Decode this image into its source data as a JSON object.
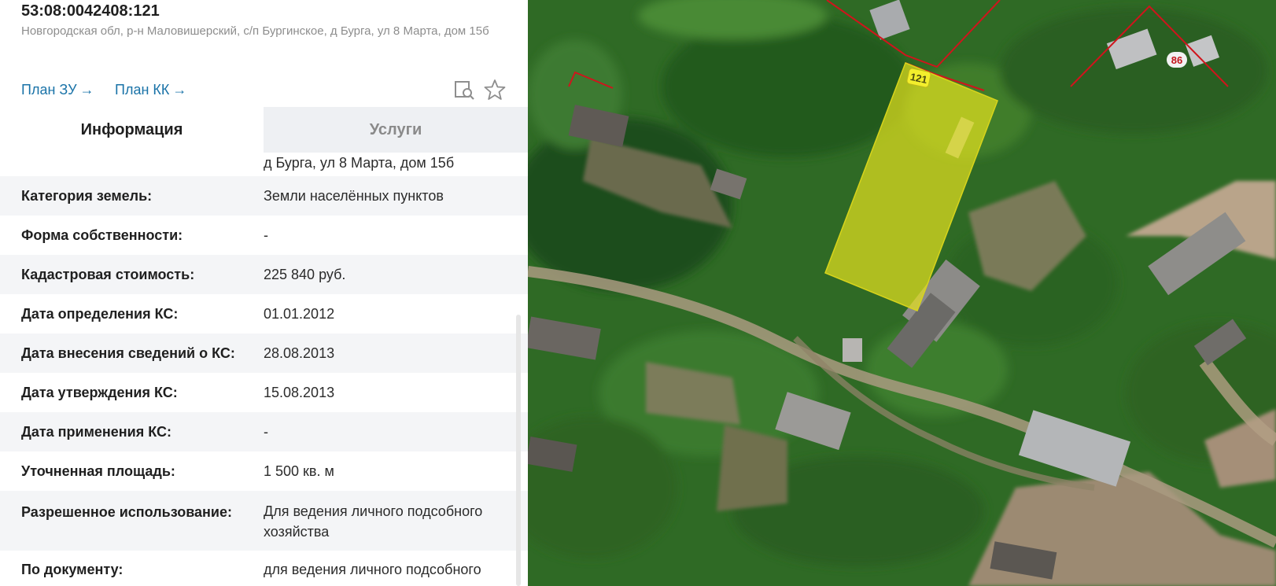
{
  "parcel": {
    "cadastral_number": "53:08:0042408:121",
    "address": "Новгородская обл, р-н Маловишерский, с/п Бургинское, д Бурга, ул 8 Марта, дом 15б"
  },
  "links": {
    "plan_zu": "План ЗУ",
    "plan_kk": "План КК",
    "arrow": "→"
  },
  "tools": {
    "search_icon": "search-doc-icon",
    "favorite_icon": "star-icon"
  },
  "tabs": {
    "info": "Информация",
    "services": "Услуги"
  },
  "details": {
    "address_tail": "д Бурга, ул 8 Марта, дом 15б",
    "rows": [
      {
        "label": "Категория земель:",
        "value": "Земли населённых пунктов"
      },
      {
        "label": "Форма собственности:",
        "value": "-"
      },
      {
        "label": "Кадастровая стоимость:",
        "value": "225 840 руб."
      },
      {
        "label": "Дата определения КС:",
        "value": "01.01.2012"
      },
      {
        "label": "Дата внесения сведений о КС:",
        "value": "28.08.2013"
      },
      {
        "label": "Дата утверждения КС:",
        "value": "15.08.2013"
      },
      {
        "label": "Дата применения КС:",
        "value": "-"
      },
      {
        "label": "Уточненная площадь:",
        "value": "1 500 кв. м"
      },
      {
        "label": "Разрешенное использование:",
        "value": "Для ведения личного подсобного хозяйства"
      },
      {
        "label": "По документу:",
        "value": "для ведения личного подсобного"
      }
    ]
  },
  "map": {
    "parcel_label": "121",
    "neighbor_label": "86",
    "colors": {
      "parcel_fill": "#e6e21e",
      "boundary": "#d0141c",
      "vegetation": "#2f6a25"
    }
  }
}
